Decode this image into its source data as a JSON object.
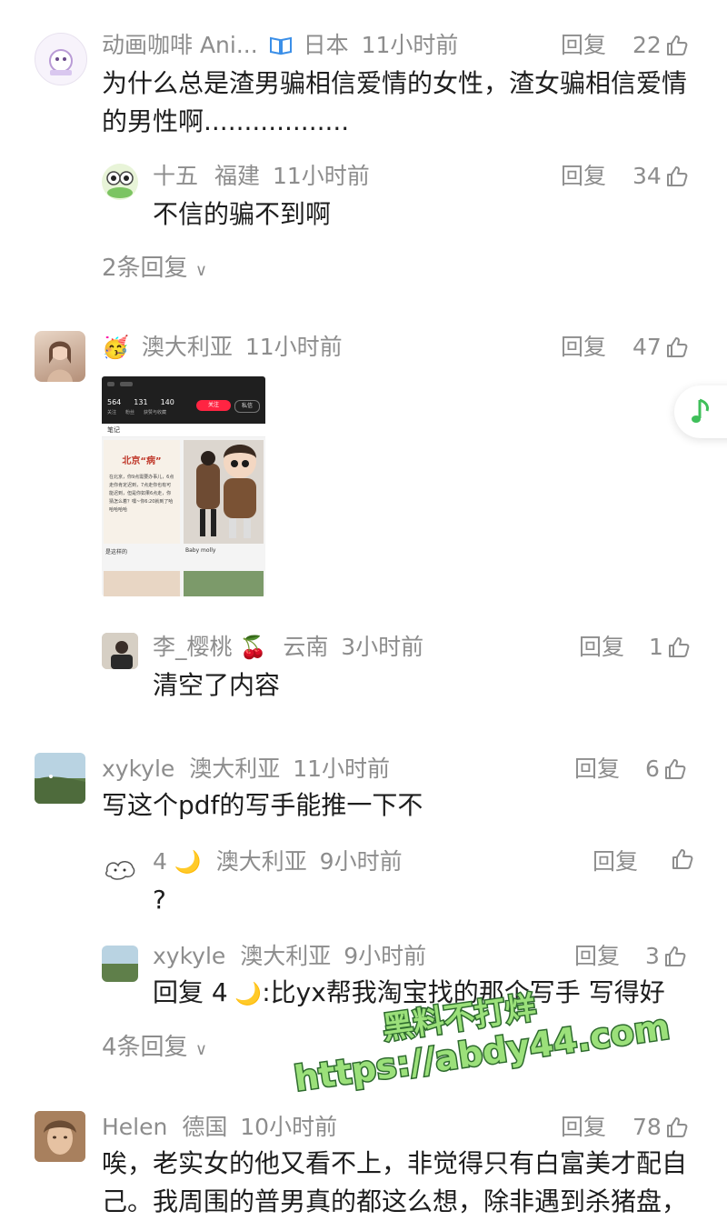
{
  "comments": [
    {
      "user": "动画咖啡 Ani...",
      "location": "日本",
      "time": "11小时前",
      "reply": "回复",
      "likes": "22",
      "text1": "为什么总是渣男骗相信爱情的女性，渣女骗相信爱情",
      "text2": "的男性啊..................",
      "replies": [
        {
          "user": "十五",
          "location": "福建",
          "time": "11小时前",
          "reply": "回复",
          "likes": "34",
          "text": "不信的骗不到啊"
        }
      ],
      "more": "2条回复"
    },
    {
      "user": "澳大利亚",
      "time": "11小时前",
      "reply": "回复",
      "likes": "47",
      "replies": [
        {
          "user": "李_樱桃",
          "location": "云南",
          "time": "3小时前",
          "reply": "回复",
          "likes": "1",
          "text": "清空了内容"
        }
      ]
    },
    {
      "user": "xykyle",
      "location": "澳大利亚",
      "time": "11小时前",
      "reply": "回复",
      "likes": "6",
      "text": "写这个pdf的写手能推一下不",
      "replies": [
        {
          "user": "4",
          "location": "澳大利亚",
          "time": "9小时前",
          "reply": "回复",
          "likes": "",
          "text": "?"
        },
        {
          "user": "xykyle",
          "location": "澳大利亚",
          "time": "9小时前",
          "reply": "回复",
          "likes": "3",
          "text_prefix": "回复 4",
          "text_suffix": ":比yx帮我淘宝找的那个写手 写得好"
        }
      ],
      "more": "4条回复"
    },
    {
      "user": "Helen",
      "location": "德国",
      "time": "10小时前",
      "reply": "回复",
      "likes": "78",
      "text1": "唉，老实女的他又看不上，非觉得只有白富美才配自",
      "text2": "己。我周围的普男真的都这么想，除非遇到杀猪盘，"
    }
  ],
  "screenshot": {
    "stats": [
      "564",
      "131",
      "140"
    ],
    "stat_labels": [
      "关注",
      "粉丝",
      "获赞与收藏"
    ],
    "follow": "关注",
    "msg": "私信",
    "notes_tab": "笔记",
    "note_title": "北京“病”",
    "note_body": "在北京，你9点需要办事儿，6点走你肯定迟到，7点走你也有可能迟到，但是你如果6点走，你猜怎么着？嘿~你6:20就到了哈哈哈哈哈",
    "card1_caption": "是这样的",
    "card2_caption": "Baby molly"
  },
  "watermark": {
    "line1": "黑料不打烊",
    "line2": "https://abdy44.com"
  },
  "colors": {
    "accent": "#ff2442",
    "text": "#1e1e1e",
    "meta": "#8d8d8d",
    "verified": "#3b8fe8",
    "music": "#3fbf5a"
  }
}
